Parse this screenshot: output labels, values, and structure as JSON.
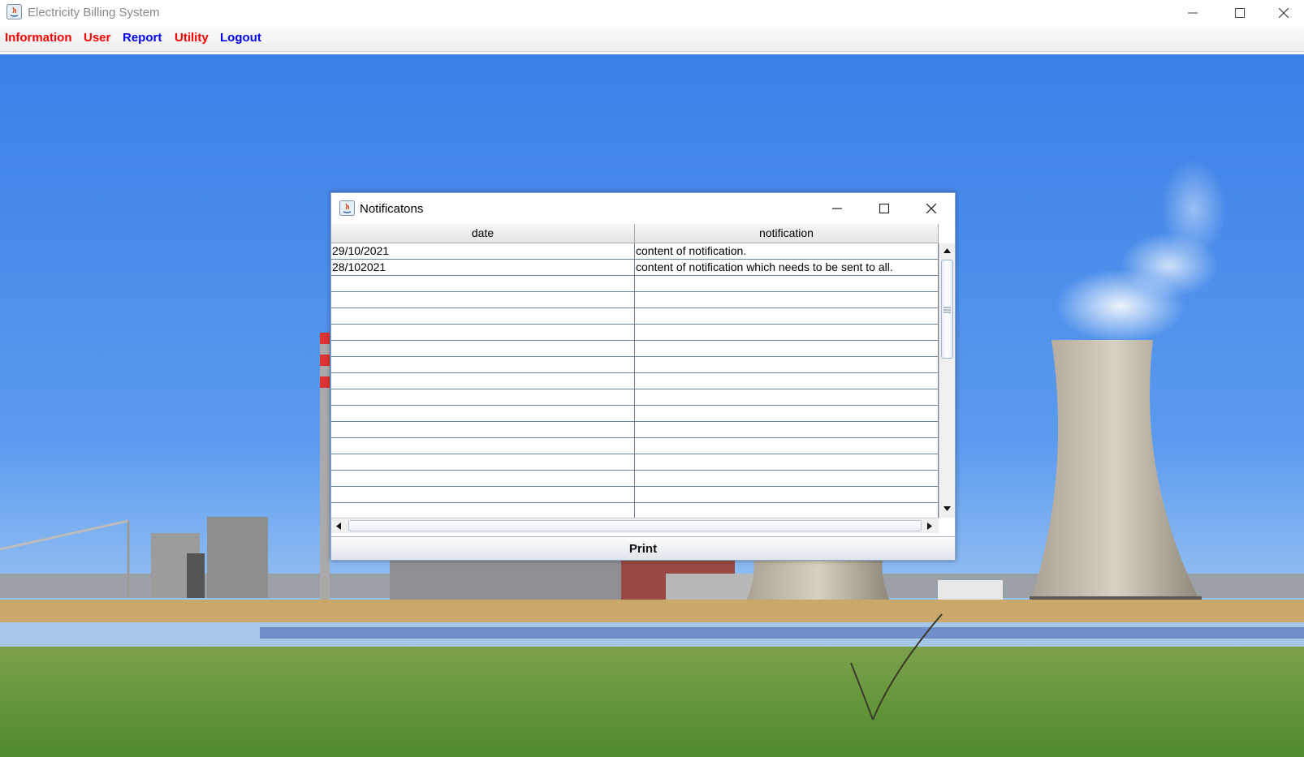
{
  "window": {
    "title": "Electricity Billing System",
    "controls": [
      "minimize-icon",
      "maximize-icon",
      "close-icon"
    ]
  },
  "menu": {
    "items": [
      {
        "label": "Information",
        "color": "#ff0000"
      },
      {
        "label": "User",
        "color": "#ff0000"
      },
      {
        "label": "Report",
        "color": "#0000ee"
      },
      {
        "label": "Utility",
        "color": "#ff0000"
      },
      {
        "label": "Logout",
        "color": "#0000ee"
      }
    ]
  },
  "dialog": {
    "title": "Notificatons",
    "table": {
      "columns": [
        "date",
        "notification"
      ],
      "rows": [
        [
          "29/10/2021",
          "content of notification."
        ],
        [
          "28/102021",
          "content of notification which needs to be sent to all."
        ]
      ]
    },
    "print_label": "Print"
  }
}
